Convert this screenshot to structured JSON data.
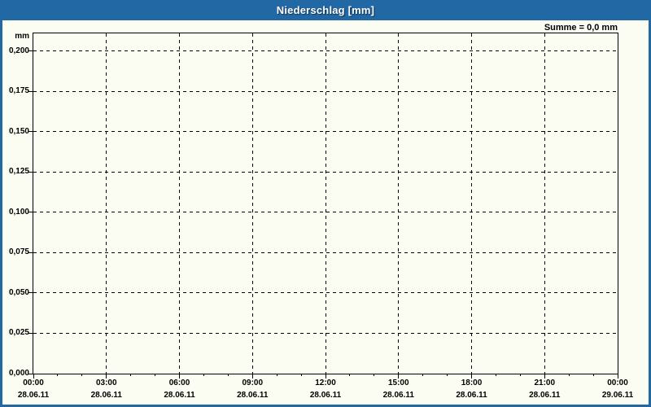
{
  "window": {
    "title": "Niederschlag [mm]"
  },
  "summary": {
    "text": "Summe = 0,0 mm"
  },
  "colors": {
    "titlebar_blue": "#2268a5",
    "background_ivory": "#fcfdf2",
    "grid_black": "#000000",
    "title_text_white": "#ffffff"
  },
  "chart_data": {
    "type": "bar",
    "title": "Niederschlag [mm]",
    "ylabel": "mm",
    "sum_annotation": "Summe = 0,0 mm",
    "ylim": [
      0,
      0.211
    ],
    "y_ticks": [
      {
        "value": 0.2,
        "label": "0,200"
      },
      {
        "value": 0.175,
        "label": "0,175"
      },
      {
        "value": 0.15,
        "label": "0,150"
      },
      {
        "value": 0.125,
        "label": "0,125"
      },
      {
        "value": 0.1,
        "label": "0,100"
      },
      {
        "value": 0.075,
        "label": "0,075"
      },
      {
        "value": 0.05,
        "label": "0,050"
      },
      {
        "value": 0.025,
        "label": "0,025"
      },
      {
        "value": 0.0,
        "label": "0,000"
      }
    ],
    "x_axis": {
      "range_hours": [
        0,
        24
      ],
      "minor_tick_step_hours": 1,
      "major_ticks": [
        {
          "hour": 0,
          "time": "00:00",
          "date": "28.06.11"
        },
        {
          "hour": 3,
          "time": "03:00",
          "date": "28.06.11"
        },
        {
          "hour": 6,
          "time": "06:00",
          "date": "28.06.11"
        },
        {
          "hour": 9,
          "time": "09:00",
          "date": "28.06.11"
        },
        {
          "hour": 12,
          "time": "12:00",
          "date": "28.06.11"
        },
        {
          "hour": 15,
          "time": "15:00",
          "date": "28.06.11"
        },
        {
          "hour": 18,
          "time": "18:00",
          "date": "28.06.11"
        },
        {
          "hour": 21,
          "time": "21:00",
          "date": "28.06.11"
        },
        {
          "hour": 24,
          "time": "00:00",
          "date": "29.06.11"
        }
      ]
    },
    "grid": {
      "horizontal": "dashed",
      "vertical": "dashed"
    },
    "legend": "none",
    "series": [
      {
        "name": "Niederschlag",
        "values": []
      }
    ]
  }
}
